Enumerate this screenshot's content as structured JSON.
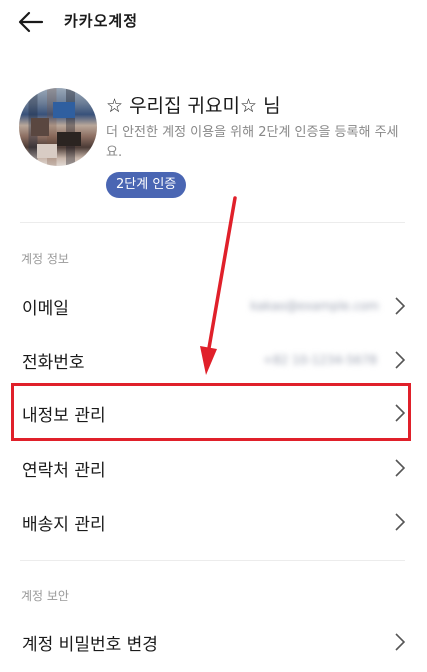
{
  "header": {
    "title": "카카오계정"
  },
  "profile": {
    "name": "☆ 우리집 귀요미☆ 님",
    "description": "더 안전한 계정 이용을 위해 2단계 인증을 등록해 주세요.",
    "verify_button": "2단계 인증"
  },
  "sections": [
    {
      "label": "계정 정보",
      "items": [
        {
          "label": "이메일",
          "value": "kakao@example.com"
        },
        {
          "label": "전화번호",
          "value": "+82 10-1234-5678"
        },
        {
          "label": "내정보 관리"
        },
        {
          "label": "연락처 관리"
        },
        {
          "label": "배송지 관리"
        }
      ]
    },
    {
      "label": "계정 보안",
      "items": [
        {
          "label": "계정 비밀번호 변경"
        }
      ]
    }
  ],
  "annotation": {
    "highlight_color": "#e0202a",
    "accent": "#4a66b3"
  }
}
